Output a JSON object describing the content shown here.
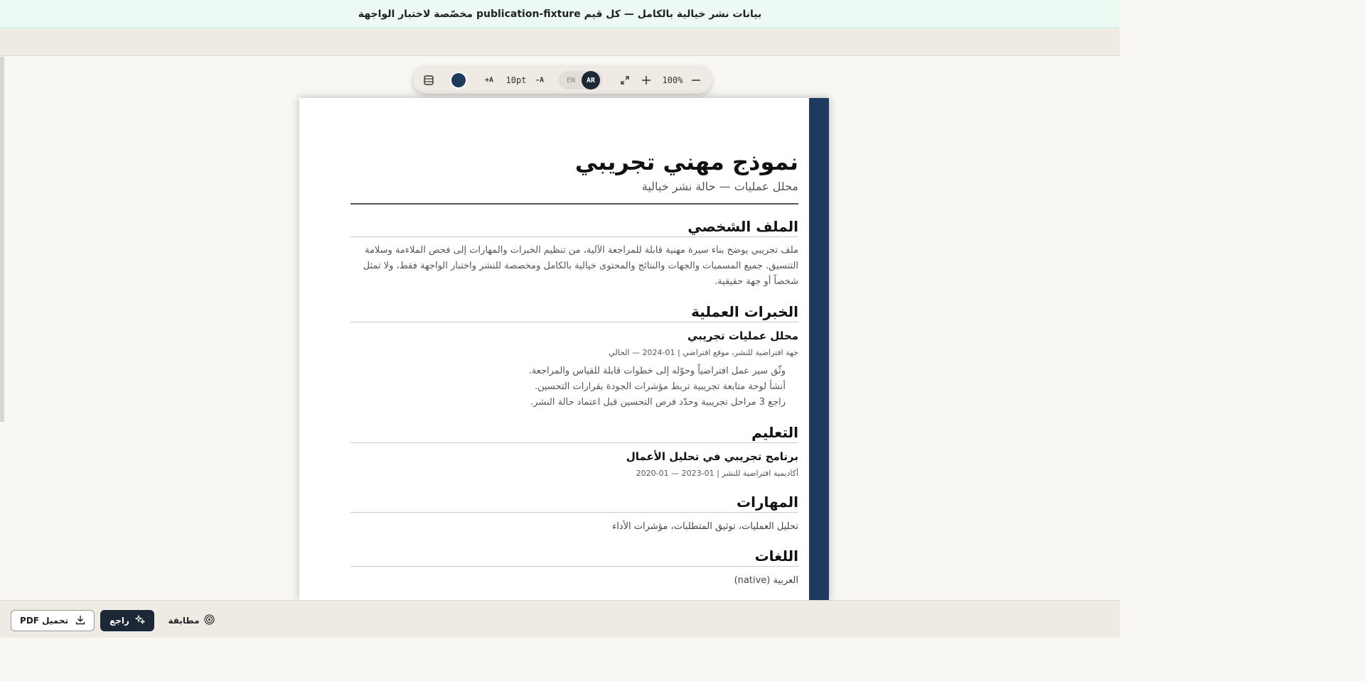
{
  "banner": {
    "text": "بيانات نشر خيالية بالكامل — كل قيم publication-fixture مخصّصة لاختبار الواجهة"
  },
  "toolbar": {
    "zoom": "100%",
    "lang_en": "EN",
    "lang_ar": "AR",
    "font_increase": "+A",
    "font_size": "10pt",
    "font_decrease": "-A",
    "accent_color": "#1e3a5f"
  },
  "resume": {
    "name": "نموذج مهني تجريبي",
    "title": "محلل عمليات — حالة نشر خيالية",
    "profile": {
      "heading": "الملف الشخصي",
      "text": "ملف تجريبي يوضح بناء سيرة مهنية قابلة للمراجعة الآلية، من تنظيم الخبرات والمهارات إلى فحص الملاءمة وسلامة التنسيق. جميع المسميات والجهات والنتائج والمحتوى خيالية بالكامل ومخصصة للنشر واختبار الواجهة فقط، ولا تمثل شخصاً أو جهة حقيقية."
    },
    "experience": {
      "heading": "الخبرات العملية",
      "job_title": "محلل عمليات تجريبي",
      "job_meta": "جهة افتراضية للنشر، موقع افتراضي | 01-2024 — الحالي",
      "bullets": [
        "وثّق سير عمل افتراضياً وحوّله إلى خطوات قابلة للقياس والمراجعة.",
        "أنشأ لوحة متابعة تجريبية تربط مؤشرات الجودة بقرارات التحسين.",
        "راجع 3 مراحل تجريبية وحدّد فرص التحسين قبل اعتماد حالة النشر."
      ]
    },
    "education": {
      "heading": "التعليم",
      "program": "برنامج تجريبي في تحليل الأعمال",
      "meta": "أكاديمية افتراضية للنشر | 01-2023 — 01-2020"
    },
    "skills": {
      "heading": "المهارات",
      "text": "تحليل العمليات، توثيق المتطلبات، مؤشرات الأداء"
    },
    "languages": {
      "heading": "اللغات",
      "text": "العربية (native)"
    }
  },
  "bottom": {
    "download_label": "تحميل PDF",
    "review_label": "راجع",
    "match_label": "مطابقة"
  }
}
